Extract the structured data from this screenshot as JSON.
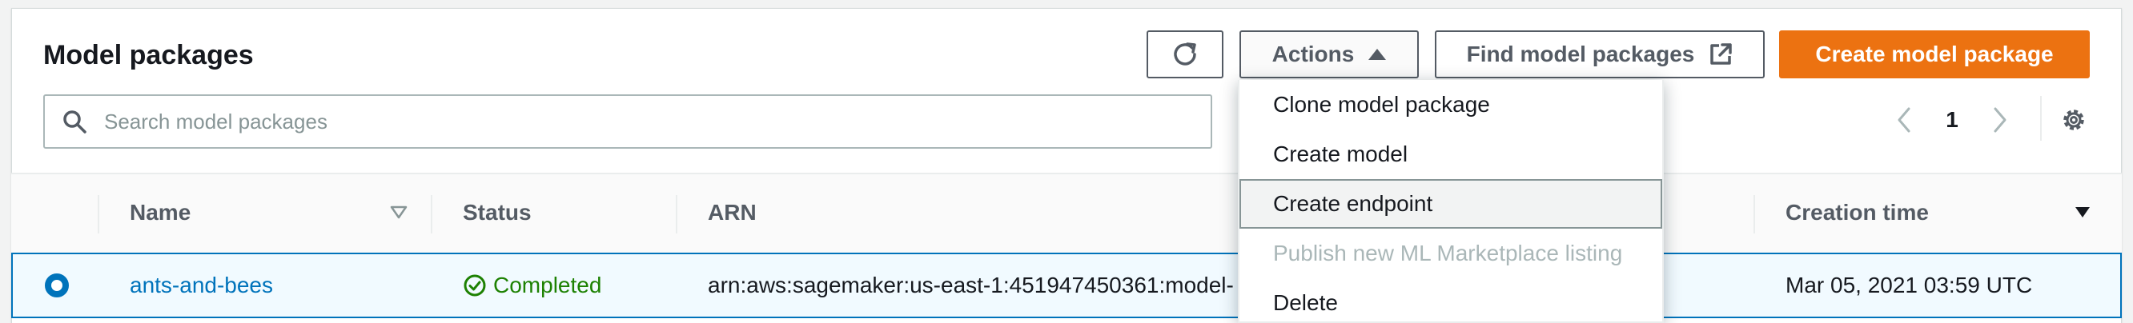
{
  "header": {
    "title": "Model packages",
    "actions_label": "Actions",
    "find_label": "Find model packages",
    "create_label": "Create model package"
  },
  "search": {
    "placeholder": "Search model packages"
  },
  "pagination": {
    "current_page": "1"
  },
  "table": {
    "columns": [
      "Name",
      "Status",
      "ARN",
      "Creation time"
    ],
    "rows": [
      {
        "name": "ants-and-bees",
        "status": "Completed",
        "arn": "arn:aws:sagemaker:us-east-1:451947450361:model-",
        "creation_time": "Mar 05, 2021 03:59 UTC",
        "selected": true
      }
    ]
  },
  "actions_menu": {
    "items": [
      {
        "label": "Clone model package",
        "state": "enabled"
      },
      {
        "label": "Create model",
        "state": "enabled"
      },
      {
        "label": "Create endpoint",
        "state": "hovered"
      },
      {
        "label": "Publish new ML Marketplace listing",
        "state": "disabled"
      },
      {
        "label": "Delete",
        "state": "enabled"
      }
    ]
  },
  "icons": {
    "refresh": "refresh-icon",
    "dropdown_open": "caret-up-icon",
    "external": "external-link-icon",
    "search": "search-icon",
    "prev": "chevron-left-icon",
    "next": "chevron-right-icon",
    "settings": "gear-icon",
    "sort_filter": "caret-down-outline-icon",
    "sort_desc": "caret-down-icon",
    "status_ok": "check-circle-icon"
  },
  "colors": {
    "primary": "#ec7211",
    "link": "#0073bb",
    "success": "#1d8102",
    "selected_row_bg": "#f1faff"
  }
}
